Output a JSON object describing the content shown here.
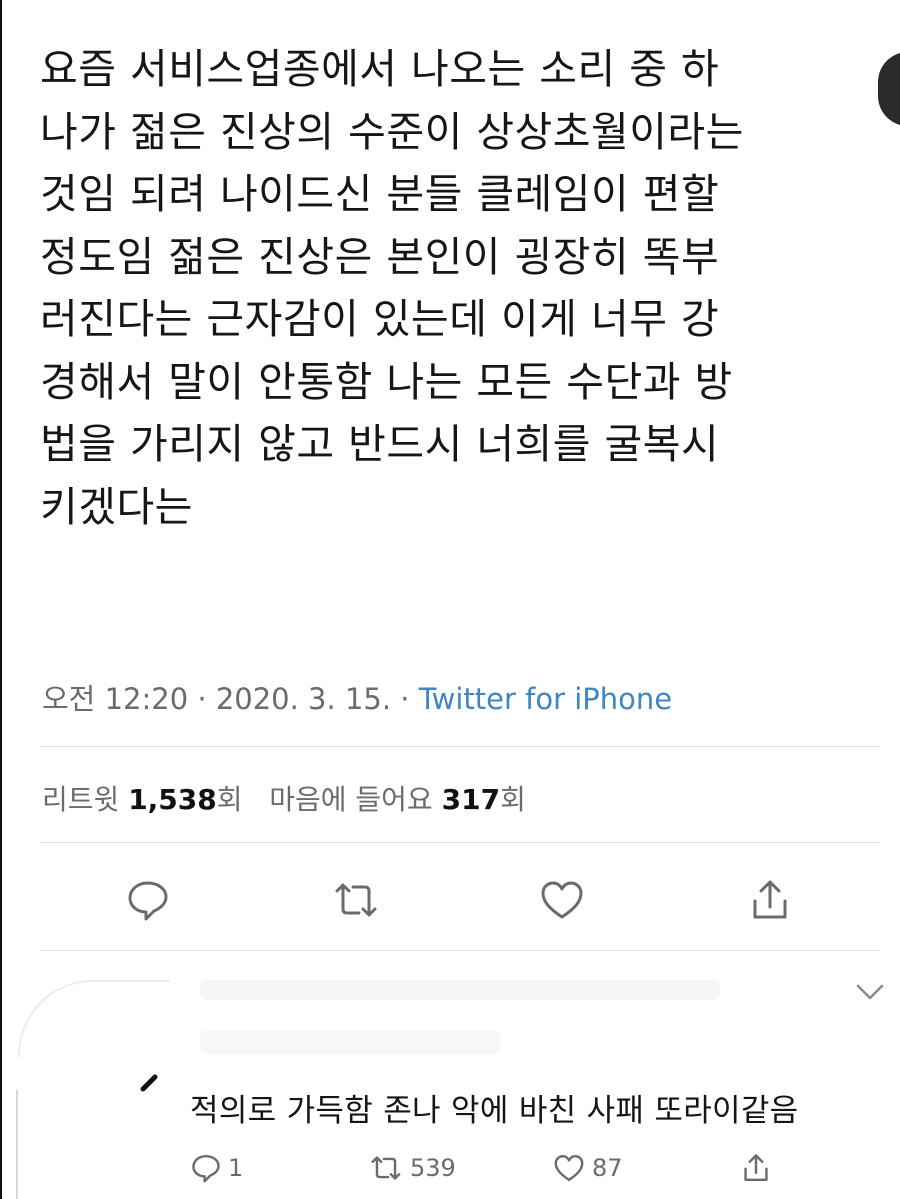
{
  "tweet": {
    "lines": [
      "요즘 서비스업종에서 나오는 소리 중 하",
      "나가 젊은 진상의 수준이 상상초월이라는",
      "것임 되려 나이드신 분들 클레임이 편할",
      "정도임 젊은 진상은 본인이 굉장히 똑부",
      "러진다는 근자감이 있는데 이게 너무 강",
      "경해서 말이 안통함 나는 모든 수단과 방",
      "법을 가리지 않고 반드시 너희를 굴복시",
      "키겠다는"
    ],
    "time": "오전 12:20",
    "sep": " · ",
    "date": "2020. 3. 15.",
    "source": "Twitter for iPhone"
  },
  "stats": {
    "retweet_label": "리트윗",
    "retweet_count": "1,538",
    "retweet_suffix": "회",
    "like_label": "마음에 들어요",
    "like_count": "317",
    "like_suffix": "회"
  },
  "actions": {
    "icons": [
      "reply-icon",
      "retweet-icon",
      "heart-icon",
      "share-icon"
    ]
  },
  "reply": {
    "text": "적의로 가득함 존나 악에 바친 사패 또라이같음",
    "reply_count": "1",
    "retweet_count": "539",
    "like_count": "87"
  },
  "colors": {
    "text": "#161616",
    "meta": "#6b6b6b",
    "link": "#3f86c5",
    "divider": "#e3e3e3"
  }
}
